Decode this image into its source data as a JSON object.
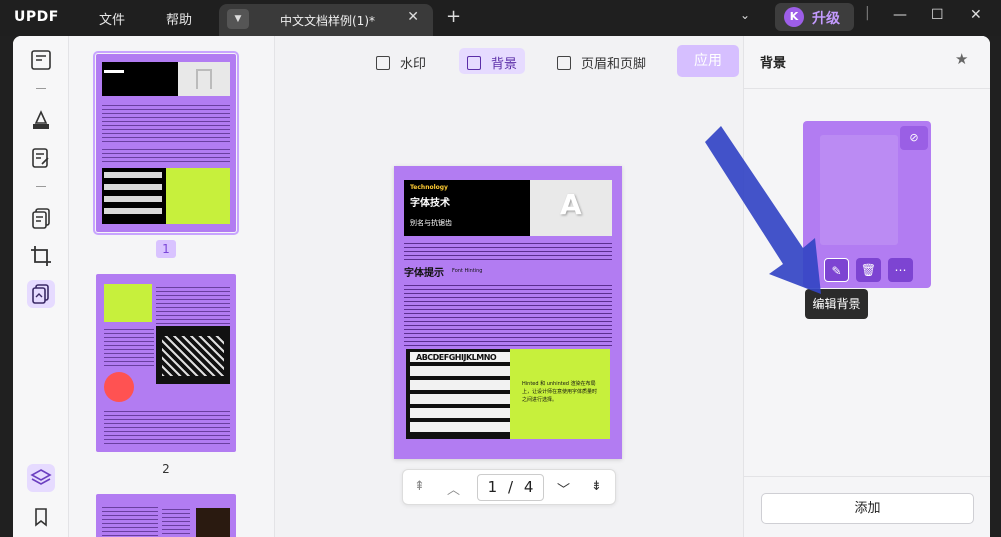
{
  "titlebar": {
    "logo": "UPDF",
    "menu_file": "文件",
    "menu_help": "帮助",
    "tab_title": "中文文档样例(1)*",
    "upgrade_avatar": "K",
    "upgrade_label": "升级"
  },
  "toolbar": {
    "watermark": "水印",
    "background": "背景",
    "header_footer": "页眉和页脚",
    "apply": "应用"
  },
  "thumbnails": [
    {
      "page": "1",
      "selected": true
    },
    {
      "page": "2",
      "selected": false
    }
  ],
  "page1": {
    "tag": "Technology",
    "heading": "字体技术",
    "sub": "别名与抗锯齿",
    "section": "字体提示",
    "section_en": "Font Hinting",
    "alphabet": "ABCDEFGHIJKLMNO",
    "side_note": "Hinted 和 unhinted 渲染在布局上，让设计师在意使用字体质量时之间进行选择。"
  },
  "navigation": {
    "current_page": "1",
    "total_pages": "4",
    "separator": "/"
  },
  "panel": {
    "title": "背景",
    "tooltip": "编辑背景",
    "add_button": "添加"
  },
  "colors": {
    "accent": "#7d44d2",
    "page_bg": "#b27cf2",
    "lime": "#c7f03c"
  }
}
